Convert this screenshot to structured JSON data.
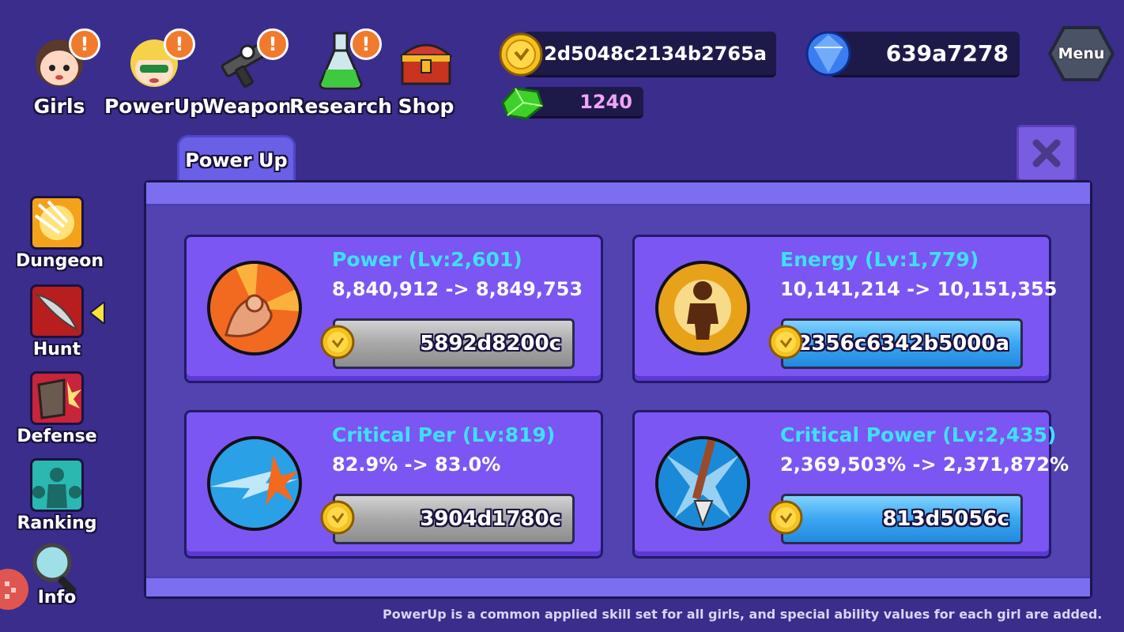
{
  "nav": {
    "girls": "Girls",
    "powerup": "PowerUp",
    "weapon": "Weapon",
    "research": "Research",
    "shop": "Shop",
    "alert_mark": "!"
  },
  "currencies": {
    "gold": "1922d5048c2134b2765a",
    "gems": "639a7278",
    "green": "1240"
  },
  "menu_label": "Menu",
  "tab_label": "Power Up",
  "cards": [
    {
      "title": "Power (Lv:2,601)",
      "values": "8,840,912 -> 8,849,753",
      "cost": "5892d8200c"
    },
    {
      "title": "Energy (Lv:1,779)",
      "values": "10,141,214 -> 10,151,355",
      "cost": "2356c6342b5000a"
    },
    {
      "title": "Critical Per (Lv:819)",
      "values": "82.9% -> 83.0%",
      "cost": "3904d1780c"
    },
    {
      "title": "Critical Power (Lv:2,435)",
      "values": "2,369,503% -> 2,371,872%",
      "cost": "813d5056c"
    }
  ],
  "side": {
    "dungeon": "Dungeon",
    "hunt": "Hunt",
    "defense": "Defense",
    "ranking": "Ranking",
    "info": "Info"
  },
  "footer": "PowerUp is a common applied skill set for all girls, and special ability values for each girl are added.",
  "colors": {
    "background": "#3a2d8c",
    "card": "#7c56f2",
    "title_cyan": "#3fe0ff",
    "alert_orange": "#f27a2c"
  }
}
